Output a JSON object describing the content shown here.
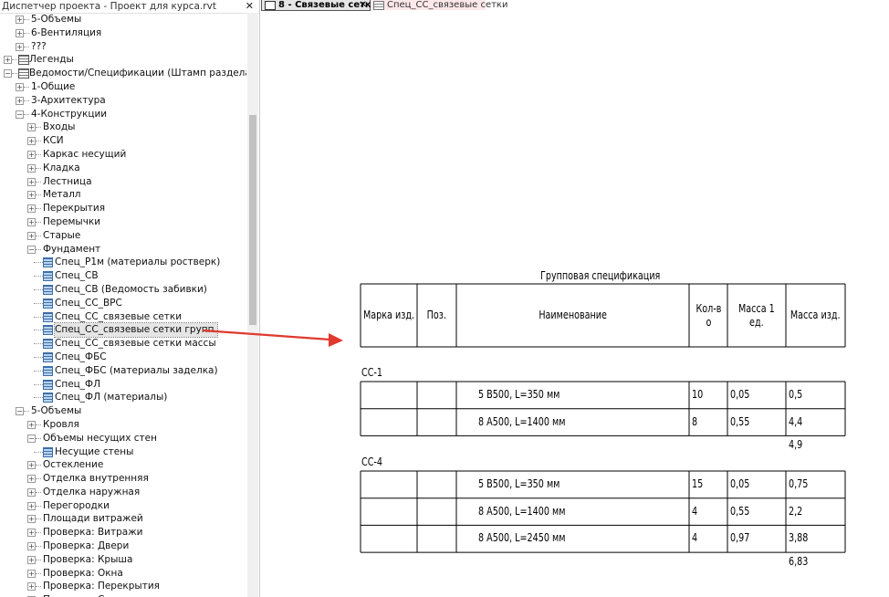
{
  "browser": {
    "title": "Диспетчер проекта - Проект для курса.rvt",
    "close_glyph": "✕",
    "rows": [
      {
        "depth": 1,
        "tog": "+",
        "icon": "",
        "label": "5-Объемы"
      },
      {
        "depth": 1,
        "tog": "+",
        "icon": "",
        "label": "6-Вентиляция"
      },
      {
        "depth": 1,
        "tog": "+",
        "icon": "",
        "label": "???"
      },
      {
        "depth": 0,
        "tog": "+",
        "icon": "sched",
        "label": "Легенды"
      },
      {
        "depth": 0,
        "tog": "−",
        "icon": "sched",
        "label": "Ведомости/Спецификации (Штамп раздела-Назнач"
      },
      {
        "depth": 1,
        "tog": "+",
        "icon": "",
        "label": "1-Общие"
      },
      {
        "depth": 1,
        "tog": "+",
        "icon": "",
        "label": "3-Архитектура"
      },
      {
        "depth": 1,
        "tog": "−",
        "icon": "",
        "label": "4-Конструкции"
      },
      {
        "depth": 2,
        "tog": "+",
        "icon": "",
        "label": "Входы"
      },
      {
        "depth": 2,
        "tog": "+",
        "icon": "",
        "label": "КСИ"
      },
      {
        "depth": 2,
        "tog": "+",
        "icon": "",
        "label": "Каркас несущий"
      },
      {
        "depth": 2,
        "tog": "+",
        "icon": "",
        "label": "Кладка"
      },
      {
        "depth": 2,
        "tog": "+",
        "icon": "",
        "label": "Лестница"
      },
      {
        "depth": 2,
        "tog": "+",
        "icon": "",
        "label": "Металл"
      },
      {
        "depth": 2,
        "tog": "+",
        "icon": "",
        "label": "Перекрытия"
      },
      {
        "depth": 2,
        "tog": "+",
        "icon": "",
        "label": "Перемычки"
      },
      {
        "depth": 2,
        "tog": "+",
        "icon": "",
        "label": "Старые"
      },
      {
        "depth": 2,
        "tog": "−",
        "icon": "",
        "label": "Фундамент"
      },
      {
        "depth": 3,
        "tog": "",
        "icon": "sheet",
        "label": "Спец_Р1м (материалы ростверк)"
      },
      {
        "depth": 3,
        "tog": "",
        "icon": "sheet",
        "label": "Спец_СВ"
      },
      {
        "depth": 3,
        "tog": "",
        "icon": "sheet",
        "label": "Спец_СВ (Ведомость забивки)"
      },
      {
        "depth": 3,
        "tog": "",
        "icon": "sheet",
        "label": "Спец_СС_ВРС"
      },
      {
        "depth": 3,
        "tog": "",
        "icon": "sheet",
        "label": "Спец_СС_связевые сетки"
      },
      {
        "depth": 3,
        "tog": "",
        "icon": "sheet",
        "label": "Спец_СС_связевые сетки групп.",
        "selected": true
      },
      {
        "depth": 3,
        "tog": "",
        "icon": "sheet",
        "label": "Спец_СС_связевые сетки массы"
      },
      {
        "depth": 3,
        "tog": "",
        "icon": "sheet",
        "label": "Спец_ФБС"
      },
      {
        "depth": 3,
        "tog": "",
        "icon": "sheet",
        "label": "Спец_ФБС (материалы заделка)"
      },
      {
        "depth": 3,
        "tog": "",
        "icon": "sheet",
        "label": "Спец_ФЛ"
      },
      {
        "depth": 3,
        "tog": "",
        "icon": "sheet",
        "label": "Спец_ФЛ (материалы)"
      },
      {
        "depth": 1,
        "tog": "−",
        "icon": "",
        "label": "5-Объемы"
      },
      {
        "depth": 2,
        "tog": "+",
        "icon": "",
        "label": "Кровля"
      },
      {
        "depth": 2,
        "tog": "−",
        "icon": "",
        "label": "Объемы несущих стен"
      },
      {
        "depth": 3,
        "tog": "",
        "icon": "sheet",
        "label": "Несущие стены"
      },
      {
        "depth": 2,
        "tog": "+",
        "icon": "",
        "label": "Остекление"
      },
      {
        "depth": 2,
        "tog": "+",
        "icon": "",
        "label": "Отделка внутренняя"
      },
      {
        "depth": 2,
        "tog": "+",
        "icon": "",
        "label": "Отделка наружная"
      },
      {
        "depth": 2,
        "tog": "+",
        "icon": "",
        "label": "Перегородки"
      },
      {
        "depth": 2,
        "tog": "+",
        "icon": "",
        "label": "Площади витражей"
      },
      {
        "depth": 2,
        "tog": "+",
        "icon": "",
        "label": "Проверка: Витражи"
      },
      {
        "depth": 2,
        "tog": "+",
        "icon": "",
        "label": "Проверка: Двери"
      },
      {
        "depth": 2,
        "tog": "+",
        "icon": "",
        "label": "Проверка: Крыша"
      },
      {
        "depth": 2,
        "tog": "+",
        "icon": "",
        "label": "Проверка: Окна"
      },
      {
        "depth": 2,
        "tog": "+",
        "icon": "",
        "label": "Проверка: Перекрытия"
      },
      {
        "depth": 2,
        "tog": "+",
        "icon": "",
        "label": "Проверка: С..."
      }
    ]
  },
  "tabs": {
    "active_label": "8 - Связевые сетки",
    "active_close": "✕",
    "inactive_label": "Спец_СС_связевые сетки"
  },
  "schedule": {
    "title": "Групповая спецификация",
    "headers": [
      "Марка изд.",
      "Поз.",
      "Наименование",
      "Кол-в\nо",
      "Масса 1\nед.",
      "Масса изд."
    ],
    "groups": [
      {
        "name": "СС-1",
        "rows": [
          {
            "name": "5 В500, L=350 мм",
            "qty": "10",
            "mass1": "0,05",
            "mass": "0,5"
          },
          {
            "name": "8 А500, L=1400 мм",
            "qty": "8",
            "mass1": "0,55",
            "mass": "4,4"
          }
        ],
        "total": "4,9"
      },
      {
        "name": "СС-4",
        "rows": [
          {
            "name": "5 В500, L=350 мм",
            "qty": "15",
            "mass1": "0,05",
            "mass": "0,75"
          },
          {
            "name": "8 А500, L=1400 мм",
            "qty": "4",
            "mass1": "0,55",
            "mass": "2,2"
          },
          {
            "name": "8 А500, L=2450 мм",
            "qty": "4",
            "mass1": "0,97",
            "mass": "3,88"
          }
        ],
        "total": "6,83"
      }
    ]
  },
  "colors": {
    "arrow": "#e0392d",
    "selected_row": "#e5e5e5",
    "active_tab_bg": "#e6e6e6",
    "inactive_tab_bg": "#fde8ea"
  }
}
